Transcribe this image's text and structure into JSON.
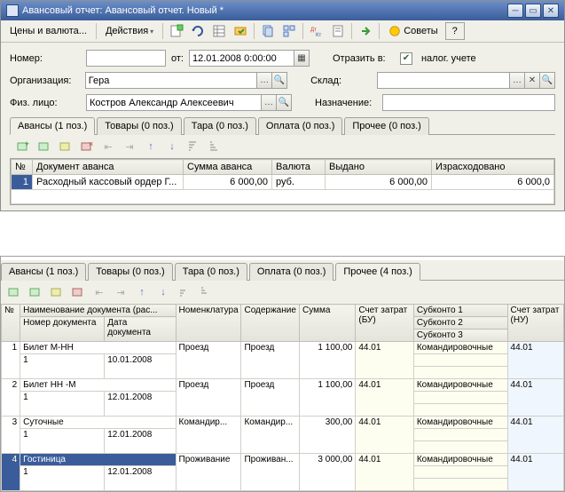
{
  "window": {
    "title": "Авансовый отчет: Авансовый отчет. Новый *"
  },
  "menu": {
    "currency": "Цены и валюта...",
    "actions": "Действия",
    "advice": "Советы"
  },
  "form": {
    "number_label": "Номер:",
    "number_value": "",
    "from_label": "от:",
    "date_value": "12.01.2008 0:00:00",
    "reflect_label": "Отразить в:",
    "tax_checked": true,
    "tax_label": "налог. учете",
    "org_label": "Организация:",
    "org_value": "Гера",
    "warehouse_label": "Склад:",
    "warehouse_value": "",
    "person_label": "Физ. лицо:",
    "person_value": "Костров Александр Алексеевич",
    "purpose_label": "Назначение:",
    "purpose_value": ""
  },
  "tabs_top": {
    "advances": "Авансы (1 поз.)",
    "goods": "Товары (0 поз.)",
    "tare": "Тара (0 поз.)",
    "payment": "Оплата (0 поз.)",
    "other": "Прочее (0 поз.)"
  },
  "grid_top": {
    "headers": {
      "n": "№",
      "doc": "Документ аванса",
      "sum": "Сумма аванса",
      "currency": "Валюта",
      "issued": "Выдано",
      "spent": "Израсходовано"
    },
    "row": {
      "n": "1",
      "doc": "Расходный кассовый ордер Г...",
      "sum": "6 000,00",
      "currency": "руб.",
      "issued": "6 000,00",
      "spent": "6 000,0"
    }
  },
  "tabs_bottom": {
    "advances": "Авансы (1 поз.)",
    "goods": "Товары (0 поз.)",
    "tare": "Тара (0 поз.)",
    "payment": "Оплата (0 поз.)",
    "other": "Прочее (4 поз.)"
  },
  "grid_bottom": {
    "headers": {
      "n": "№",
      "docname": "Наименование документа (рас...",
      "docnum": "Номер документа",
      "docdate": "Дата документа",
      "nomen": "Номенклатура",
      "content": "Содержание",
      "sum": "Сумма",
      "account_bu": "Счет затрат (БУ)",
      "sub1": "Субконто 1",
      "sub2": "Субконто 2",
      "sub3": "Субконто 3",
      "account_nu": "Счет затрат (НУ)"
    },
    "rows": [
      {
        "n": "1",
        "name": "Билет М-НН",
        "num": "1",
        "date": "10.01.2008",
        "nomen": "",
        "content1": "Проезд",
        "content2": "Проезд",
        "sum": "1 100,00",
        "acc_bu": "44.01",
        "sub": "Командировочные",
        "acc_nu": "44.01"
      },
      {
        "n": "2",
        "name": "Билет НН -М",
        "num": "1",
        "date": "12.01.2008",
        "nomen": "",
        "content1": "Проезд",
        "content2": "Проезд",
        "sum": "1 100,00",
        "acc_bu": "44.01",
        "sub": "Командировочные",
        "acc_nu": "44.01"
      },
      {
        "n": "3",
        "name": "Суточные",
        "num": "1",
        "date": "12.01.2008",
        "nomen": "",
        "content1": "Командир...",
        "content2": "Командир...",
        "sum": "300,00",
        "acc_bu": "44.01",
        "sub": "Командировочные",
        "acc_nu": "44.01"
      },
      {
        "n": "4",
        "name": "Гостиница",
        "num": "1",
        "date": "12.01.2008",
        "nomen": "",
        "content1": "Проживание",
        "content2": "Проживан...",
        "sum": "3 000,00",
        "acc_bu": "44.01",
        "sub": "Командировочные",
        "acc_nu": "44.01"
      }
    ]
  }
}
